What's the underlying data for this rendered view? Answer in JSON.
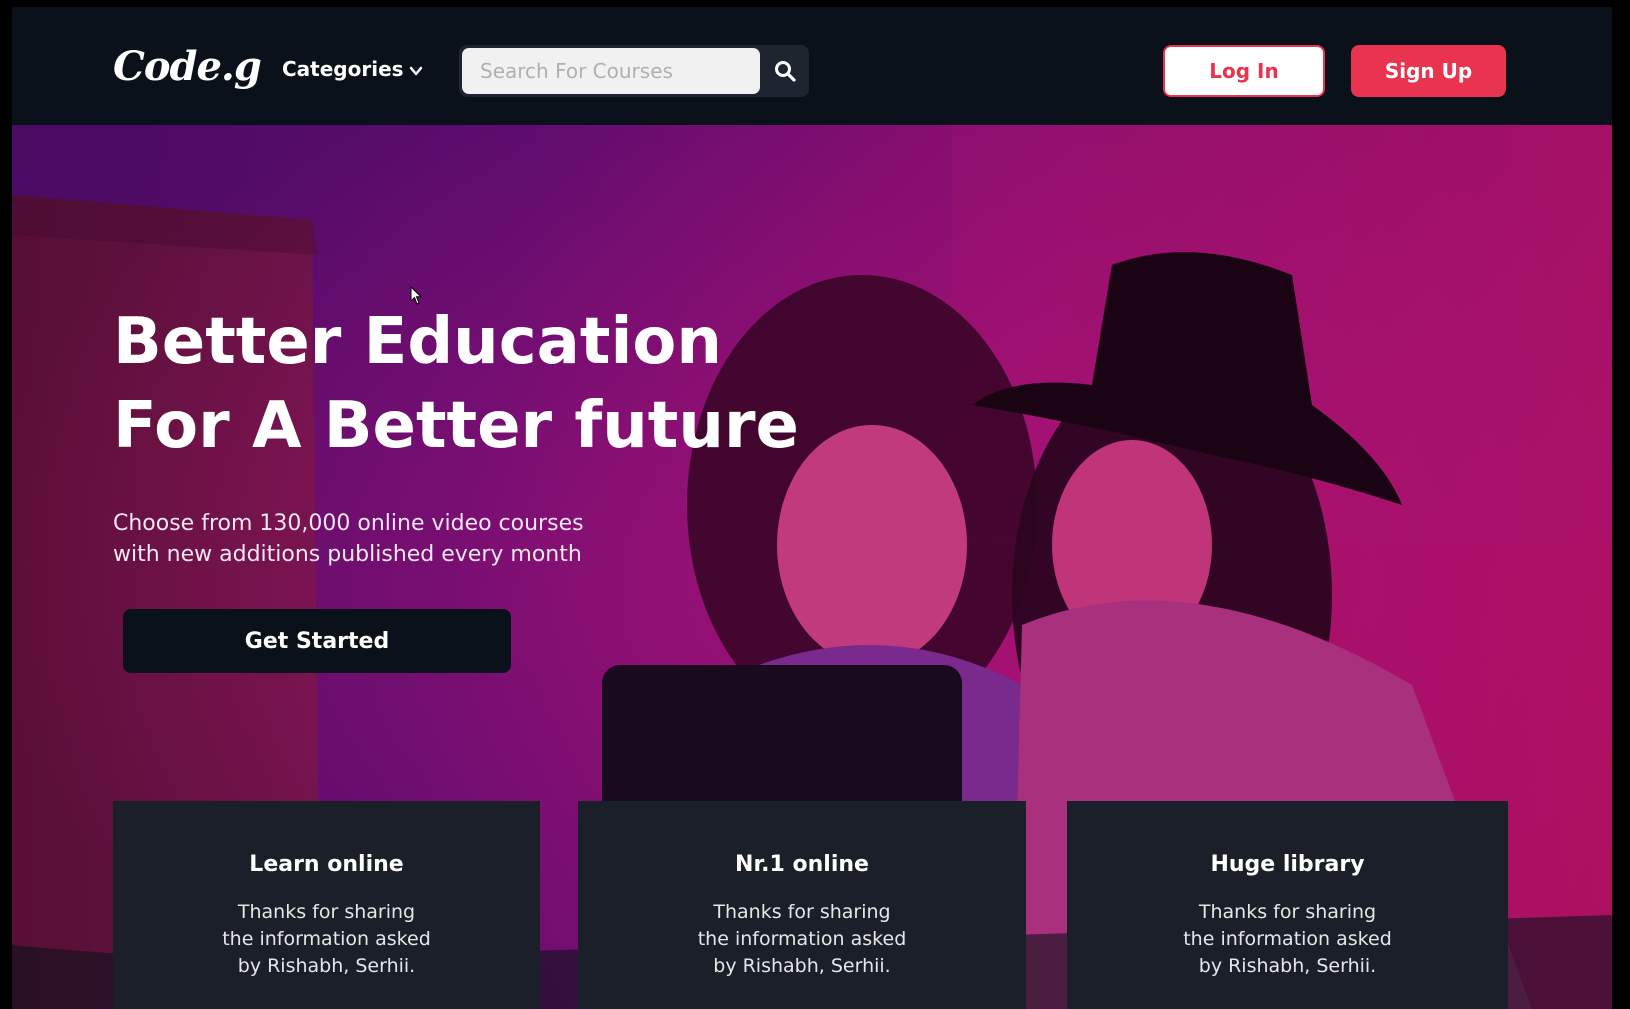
{
  "header": {
    "logo": "Code.g",
    "categories_label": "Categories",
    "search_placeholder": "Search For Courses",
    "login_label": "Log In",
    "signup_label": "Sign Up"
  },
  "hero": {
    "title_line1": "Better Education",
    "title_line2": "For A Better future",
    "subtitle_line1": "Choose from 130,000 online video courses",
    "subtitle_line2": "with new additions published every month",
    "cta_label": "Get Started"
  },
  "cards": [
    {
      "title": "Learn online",
      "line1": "Thanks for sharing",
      "line2": "the information asked",
      "line3": "by Rishabh, Serhii."
    },
    {
      "title": "Nr.1 online",
      "line1": "Thanks for sharing",
      "line2": "the information asked",
      "line3": "by Rishabh, Serhii."
    },
    {
      "title": "Huge library",
      "line1": "Thanks for sharing",
      "line2": "the information asked",
      "line3": "by Rishabh, Serhii."
    }
  ],
  "colors": {
    "accent": "#e8344e",
    "header_bg": "#0b111b",
    "card_bg": "#1a1f29"
  },
  "icons": [
    "chevron-down-icon",
    "search-icon",
    "cursor-icon"
  ]
}
